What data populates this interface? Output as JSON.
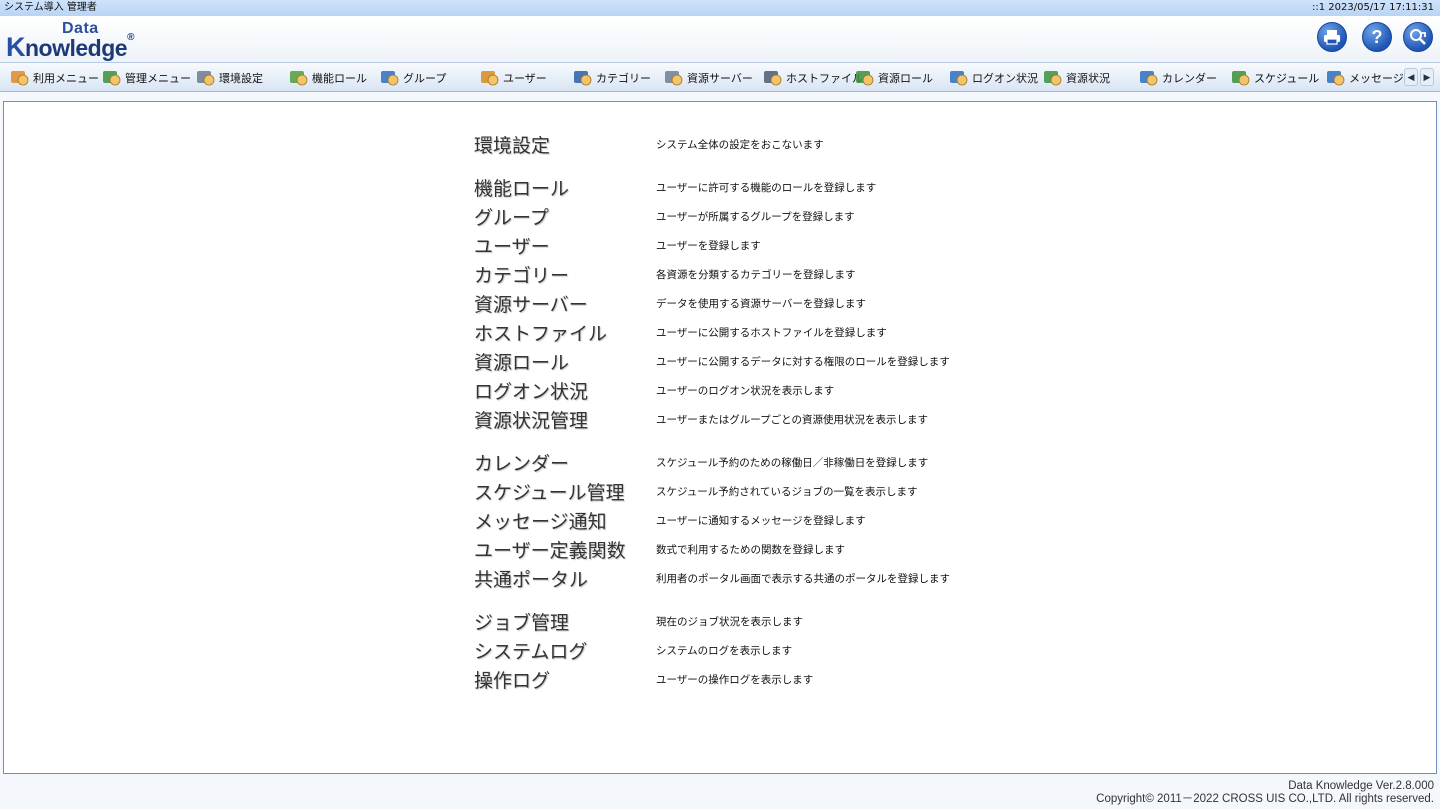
{
  "topbar": {
    "user": "システム導入 管理者",
    "clock": "::1  2023/05/17 17:11:31"
  },
  "logo": {
    "line1": "Data",
    "line2_first": "K",
    "line2_rest": "nowledge",
    "reg": "®"
  },
  "header_buttons": [
    {
      "icon": "print-icon",
      "label": ""
    },
    {
      "icon": "help-icon",
      "label": "?"
    },
    {
      "icon": "logout-icon",
      "label": ""
    }
  ],
  "toolbar": {
    "items": [
      {
        "label": "利用メニュー",
        "icon": "user-menu-icon",
        "color": "#e08a2c"
      },
      {
        "label": "管理メニュー",
        "icon": "admin-menu-icon",
        "color": "#3a8f3a"
      },
      {
        "label": "環境設定",
        "icon": "settings-gear-icon",
        "color": "#6b7b8c"
      },
      {
        "label": "機能ロール",
        "icon": "function-role-icon",
        "color": "#4f9d3c"
      },
      {
        "label": "グループ",
        "icon": "group-icon",
        "color": "#2d6fc0"
      },
      {
        "label": "ユーザー",
        "icon": "user-icon",
        "color": "#d68a1e"
      },
      {
        "label": "カテゴリー",
        "icon": "category-icon",
        "color": "#2a5fa8"
      },
      {
        "label": "資源サーバー",
        "icon": "resource-server-icon",
        "color": "#6d7f93"
      },
      {
        "label": "ホストファイル",
        "icon": "host-file-icon",
        "color": "#4a5c70"
      },
      {
        "label": "資源ロール",
        "icon": "resource-role-icon",
        "color": "#3a8f3a"
      },
      {
        "label": "ログオン状況",
        "icon": "logon-status-icon",
        "color": "#2d6fc0"
      },
      {
        "label": "資源状況",
        "icon": "resource-status-icon",
        "color": "#3a8f3a"
      },
      {
        "label": "カレンダー",
        "icon": "calendar-icon",
        "color": "#2d6fc0"
      },
      {
        "label": "スケジュール",
        "icon": "schedule-icon",
        "color": "#3a8f3a"
      },
      {
        "label": "メッセージ",
        "icon": "message-icon",
        "color": "#2d6fc0"
      }
    ],
    "scroll_left": "◀",
    "scroll_right": "▶"
  },
  "menu": [
    {
      "name": "環境設定",
      "desc": "システム全体の設定をおこないます"
    },
    {
      "name": "機能ロール",
      "desc": "ユーザーに許可する機能のロールを登録します"
    },
    {
      "name": "グループ",
      "desc": "ユーザーが所属するグループを登録します"
    },
    {
      "name": "ユーザー",
      "desc": "ユーザーを登録します"
    },
    {
      "name": "カテゴリー",
      "desc": "各資源を分類するカテゴリーを登録します"
    },
    {
      "name": "資源サーバー",
      "desc": "データを使用する資源サーバーを登録します"
    },
    {
      "name": "ホストファイル",
      "desc": "ユーザーに公開するホストファイルを登録します"
    },
    {
      "name": "資源ロール",
      "desc": "ユーザーに公開するデータに対する権限のロールを登録します"
    },
    {
      "name": "ログオン状況",
      "desc": "ユーザーのログオン状況を表示します"
    },
    {
      "name": "資源状況管理",
      "desc": "ユーザーまたはグループごとの資源使用状況を表示します"
    },
    {
      "name": "カレンダー",
      "desc": "スケジュール予約のための稼働日／非稼働日を登録します"
    },
    {
      "name": "スケジュール管理",
      "desc": "スケジュール予約されているジョブの一覧を表示します"
    },
    {
      "name": "メッセージ通知",
      "desc": "ユーザーに通知するメッセージを登録します"
    },
    {
      "name": "ユーザー定義関数",
      "desc": "数式で利用するための関数を登録します"
    },
    {
      "name": "共通ポータル",
      "desc": "利用者のポータル画面で表示する共通のポータルを登録します"
    },
    {
      "name": "ジョブ管理",
      "desc": "現在のジョブ状況を表示します"
    },
    {
      "name": "システムログ",
      "desc": "システムのログを表示します"
    },
    {
      "name": "操作ログ",
      "desc": "ユーザーの操作ログを表示します"
    }
  ],
  "footer": {
    "version": "Data Knowledge Ver.2.8.000",
    "copyright": "Copyright© 2011－2022 CROSS UIS CO.,LTD. All rights reserved."
  }
}
